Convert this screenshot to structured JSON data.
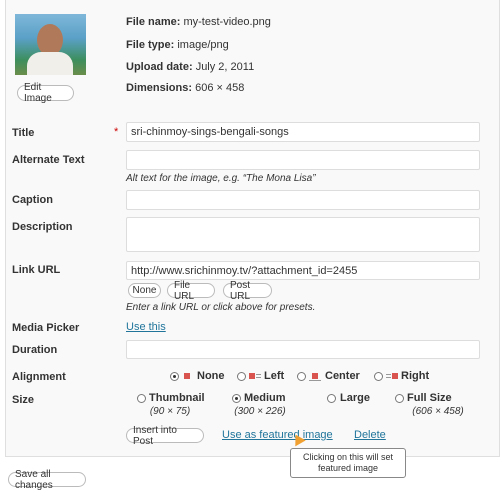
{
  "file": {
    "name_label": "File name:",
    "name": "my-test-video.png",
    "type_label": "File type:",
    "type": "image/png",
    "date_label": "Upload date:",
    "date": "July 2, 2011",
    "dim_label": "Dimensions:",
    "dimensions": "606 × 458"
  },
  "edit_image": "Edit Image",
  "labels": {
    "title": "Title",
    "required": "*",
    "alt": "Alternate Text",
    "caption": "Caption",
    "description": "Description",
    "link_url": "Link URL",
    "media_picker": "Media Picker",
    "duration": "Duration",
    "alignment": "Alignment",
    "size": "Size"
  },
  "fields": {
    "title": "sri-chinmoy-sings-bengali-songs",
    "alt": "",
    "caption": "",
    "description": "",
    "link_url": "http://www.srichinmoy.tv/?attachment_id=2455",
    "duration": ""
  },
  "help": {
    "alt": "Alt text for the image, e.g. “The Mona Lisa”",
    "link": "Enter a link URL or click above for presets."
  },
  "link_buttons": [
    "None",
    "File URL",
    "Post URL"
  ],
  "use_this": "Use this",
  "alignment": {
    "selected": "None",
    "options": [
      "None",
      "Left",
      "Center",
      "Right"
    ]
  },
  "size": {
    "selected": "Medium",
    "options": [
      {
        "label": "Thumbnail",
        "dims": "(90 × 75)"
      },
      {
        "label": "Medium",
        "dims": "(300 × 226)"
      },
      {
        "label": "Large",
        "dims": ""
      },
      {
        "label": "Full Size",
        "dims": "(606 × 458)"
      }
    ]
  },
  "actions": {
    "insert": "Insert into Post",
    "featured": "Use as featured image",
    "delete": "Delete"
  },
  "tooltip": "Clicking on this will set featured image",
  "save_all": "Save all changes",
  "colors": {
    "link": "#21759b",
    "required": "#cc0000",
    "align_icon": "#d9534f"
  }
}
